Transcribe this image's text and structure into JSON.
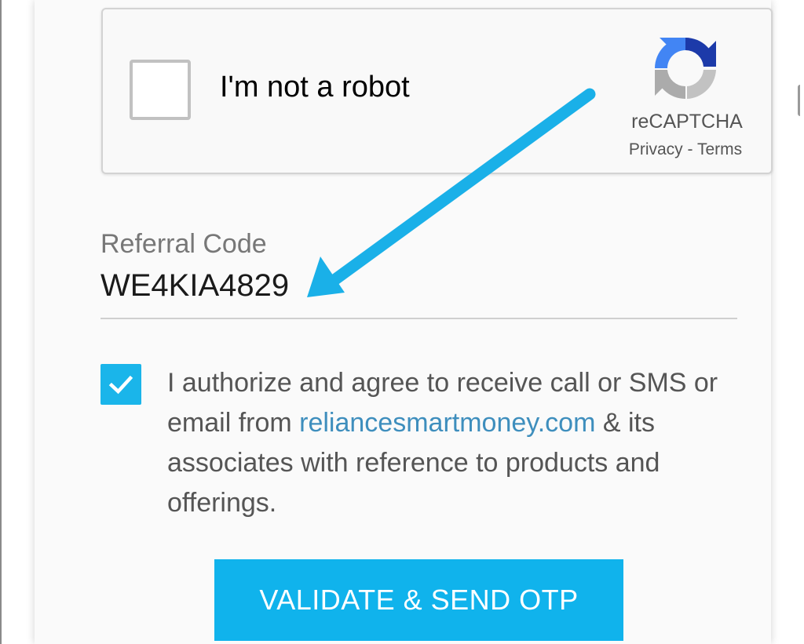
{
  "recaptcha": {
    "label": "I'm not a robot",
    "brand": "reCAPTCHA",
    "privacy": "Privacy",
    "separator": " - ",
    "terms": "Terms",
    "checked": false
  },
  "referral": {
    "label": "Referral Code",
    "value": "WE4KIA4829"
  },
  "consent": {
    "checked": true,
    "text_before": "I authorize and agree to receive call or SMS or email from ",
    "link": "reliancesmartmoney.com",
    "text_after": " & its associates with reference to products and offerings."
  },
  "submit": {
    "label": "VALIDATE & SEND OTP"
  },
  "colors": {
    "accent": "#10b3ec",
    "annotation_arrow": "#1ab0e8",
    "link": "#3e8ebd"
  },
  "icons": {
    "recaptcha_logo": "recaptcha-logo-icon",
    "consent_check": "checkmark-icon",
    "annotation": "arrow-annotation-icon"
  }
}
